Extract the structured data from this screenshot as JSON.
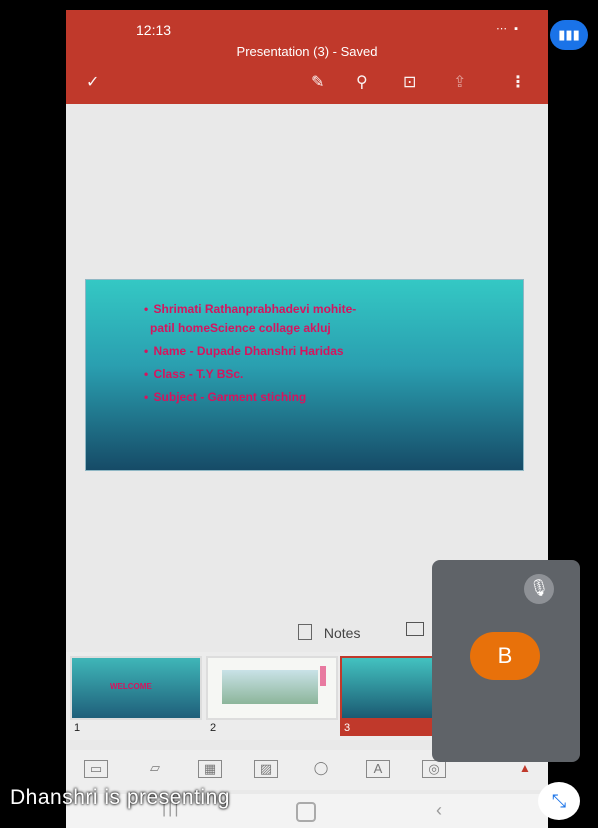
{
  "status_bar": {
    "time": "12:13",
    "icons": "⋯ ▪"
  },
  "app": {
    "title": "Presentation (3) - Saved",
    "toolbar": {
      "check_icon": "✓",
      "pen_icon": "✎",
      "search_icon": "⚲",
      "present_icon": "⊡",
      "share_icon": "⇪",
      "more_icon": "⋮"
    }
  },
  "slide": {
    "bullets": [
      {
        "line1": "Shrimati Rathanprabhadevi mohite-",
        "line2": "patil homeScience  collage akluj"
      },
      {
        "line1": "Name -  Dupade Dhanshri Haridas"
      },
      {
        "line1": "Class - T.Y BSc."
      },
      {
        "line1": "Subject -   Garment stiching"
      }
    ]
  },
  "notes_label": "Notes",
  "thumbnails": [
    {
      "number": "1",
      "text": "WELCOME"
    },
    {
      "number": "2"
    },
    {
      "number": "3"
    }
  ],
  "insert_bar_icons": [
    "▭",
    "▱",
    "▦",
    "▨",
    "◯",
    "A",
    "◎",
    "▲"
  ],
  "nav_icons": {
    "recents": "|||",
    "back": "‹"
  },
  "meeting": {
    "presenting_text": "Dhanshri is presenting",
    "participant_initial": "B",
    "mic_off_icon": "🎙",
    "badge_icon": "▮▮▮",
    "exit_icon": "⤡"
  }
}
